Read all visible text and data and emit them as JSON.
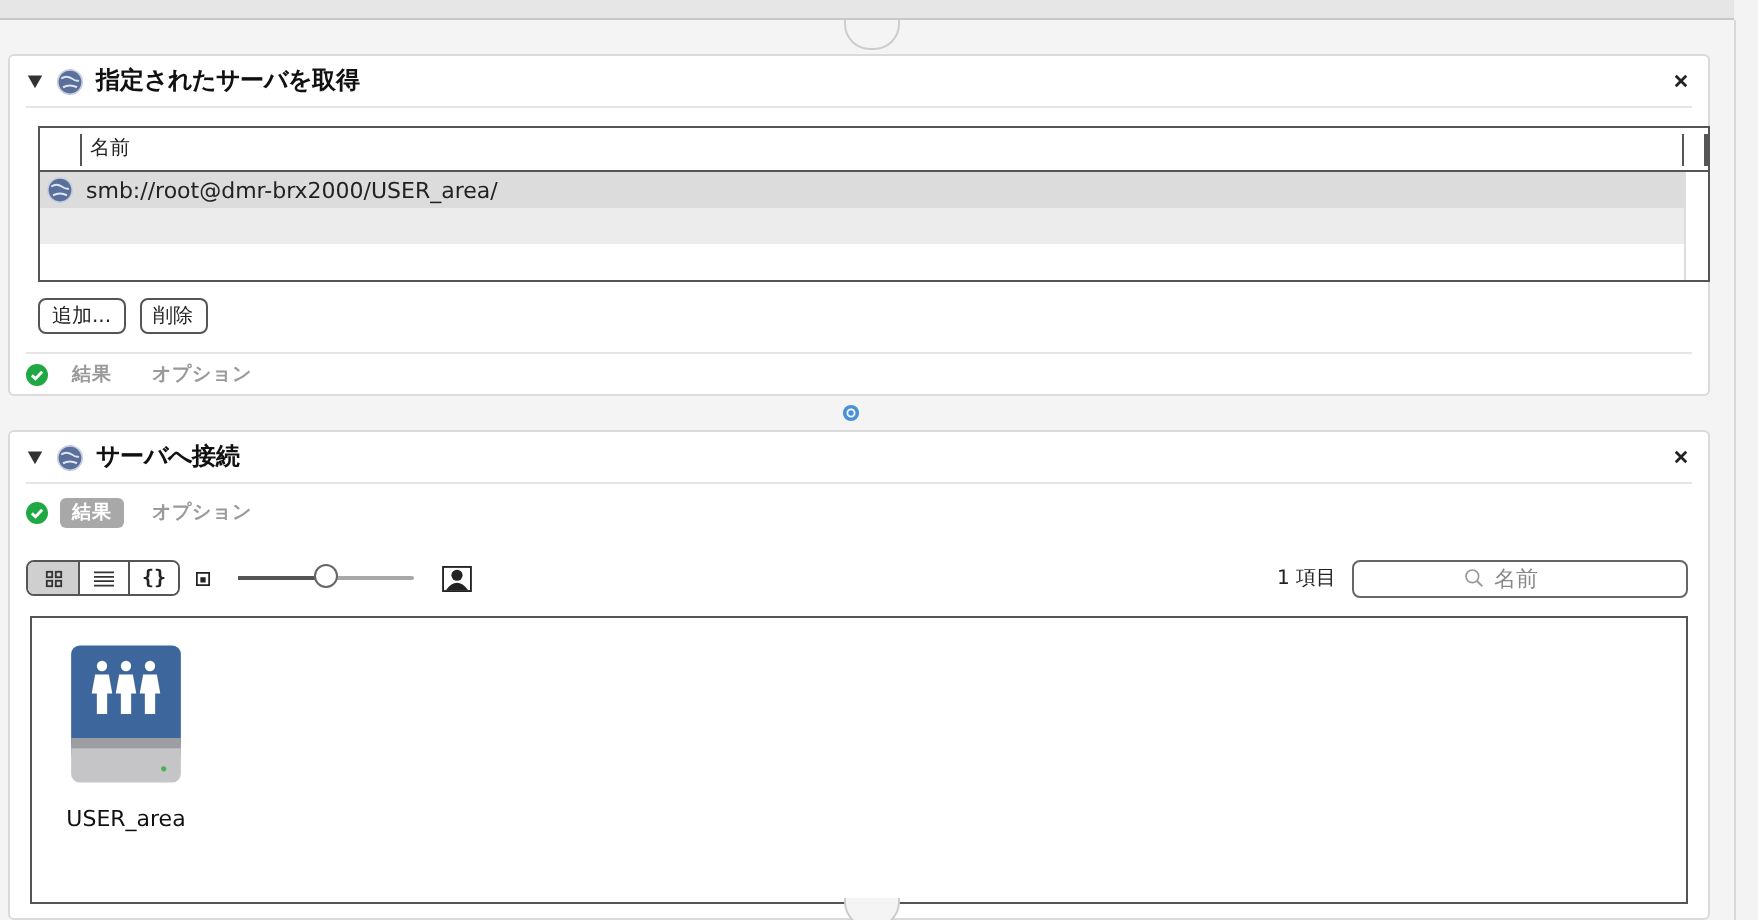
{
  "get_servers": {
    "title": "指定されたサーバを取得",
    "expanded": true,
    "column": "名前",
    "rows": [
      {
        "url": "smb://root@dmr-brx2000/USER_area/",
        "selected": true
      }
    ],
    "buttons": [
      "追加...",
      "削除"
    ],
    "tabs": [
      {
        "label": "結果",
        "selected": false
      },
      {
        "label": "オプション",
        "selected": false
      }
    ]
  },
  "connect": {
    "title": "サーバへ接続",
    "expanded": true,
    "tabs": [
      {
        "label": "結果",
        "selected": true
      },
      {
        "label": "オプション",
        "selected": false
      }
    ],
    "view_modes": [
      {
        "kind": "icons",
        "selected": true
      },
      {
        "kind": "list",
        "selected": false
      },
      {
        "kind": "code",
        "label": "{}",
        "selected": false
      }
    ],
    "size_slider": {
      "level": 0.5
    },
    "count": "1 項目",
    "search": {
      "placeholder": "名前"
    },
    "files": [
      {
        "name": "USER_area",
        "kind": "shared_drive"
      }
    ]
  }
}
